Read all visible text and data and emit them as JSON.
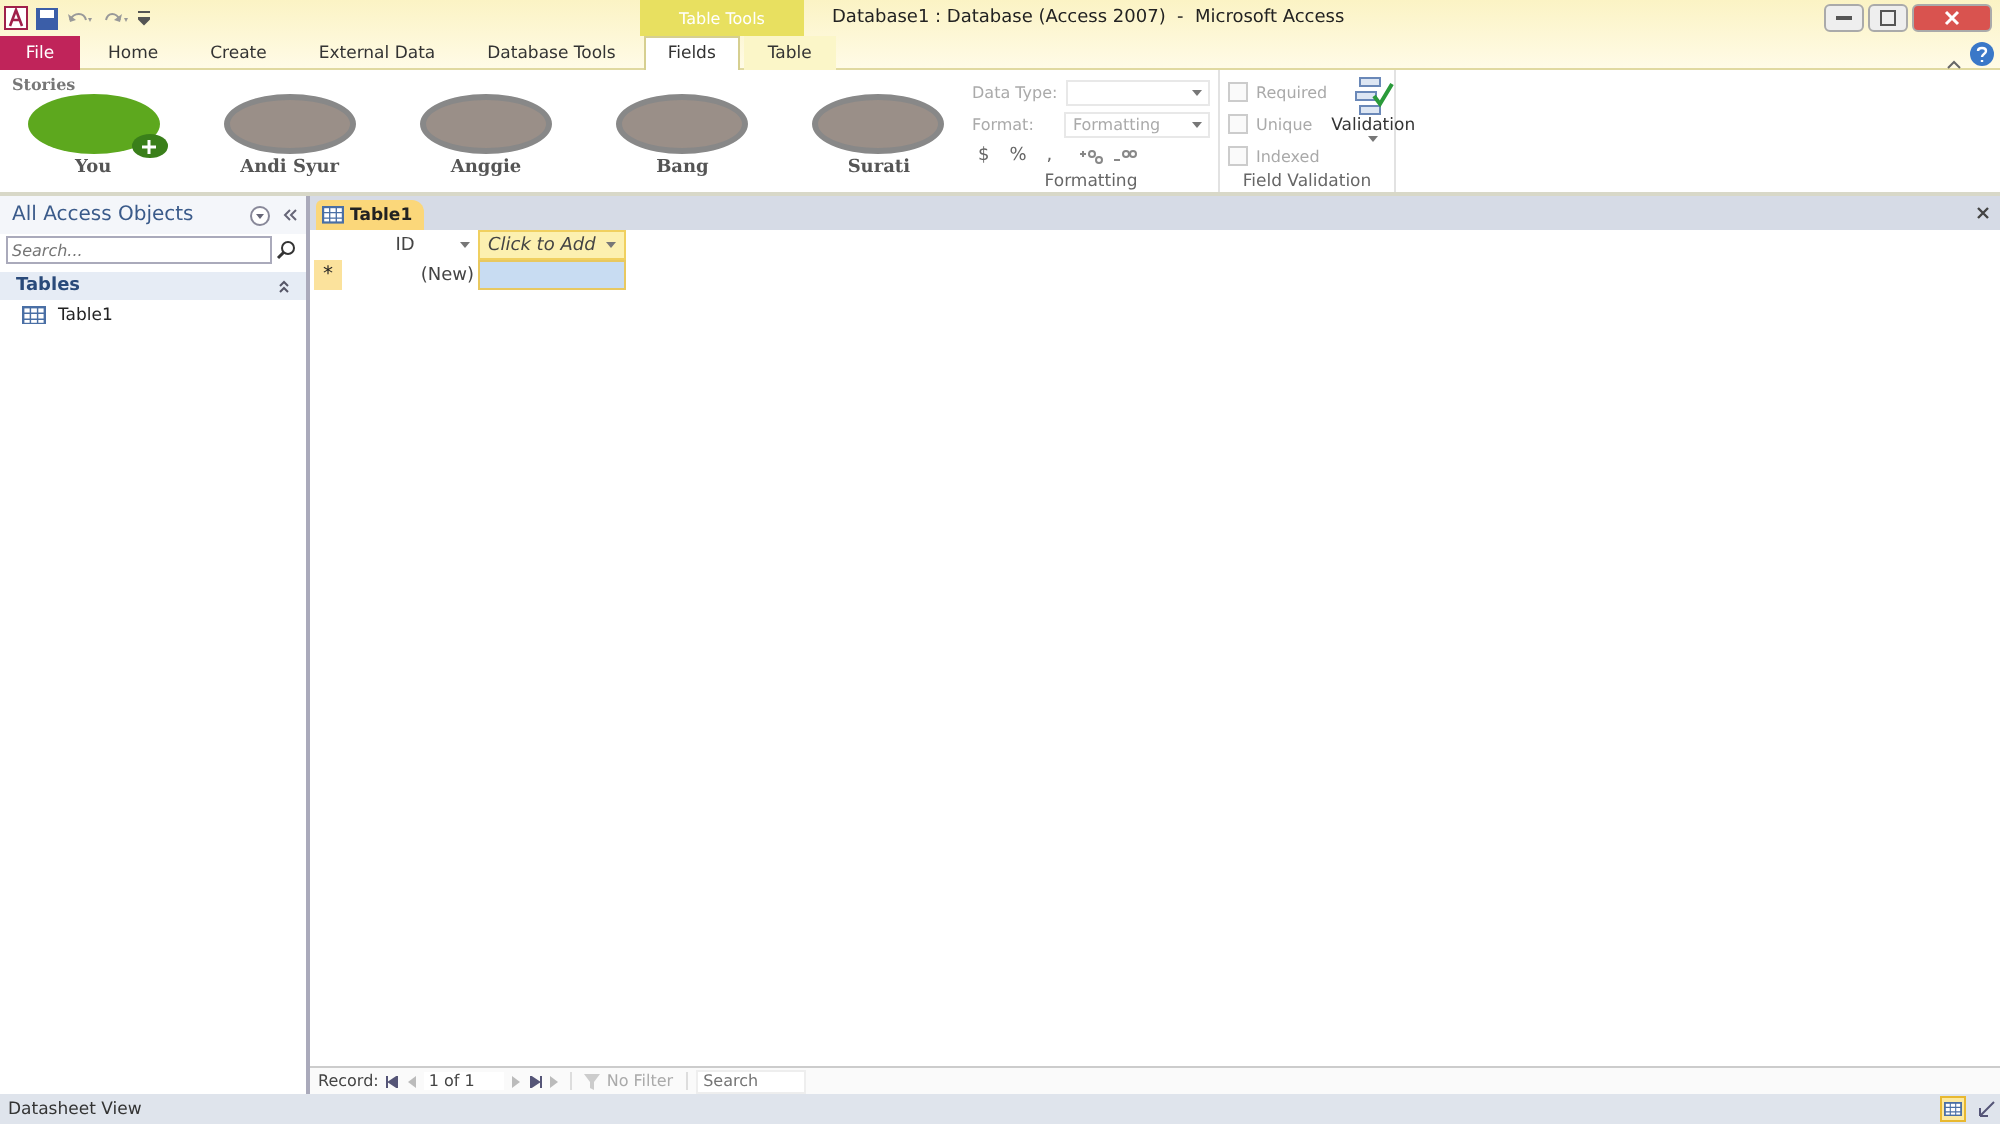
{
  "window": {
    "title": "Database1 : Database (Access 2007)  -  Microsoft Access",
    "context_group": "Table Tools"
  },
  "ribbon_tabs": [
    {
      "label": "File",
      "kind": "file",
      "selected": false
    },
    {
      "label": "Home",
      "kind": "normal",
      "selected": false
    },
    {
      "label": "Create",
      "kind": "normal",
      "selected": false
    },
    {
      "label": "External Data",
      "kind": "normal",
      "selected": false
    },
    {
      "label": "Database Tools",
      "kind": "normal",
      "selected": false
    },
    {
      "label": "Fields",
      "kind": "context",
      "selected": true
    },
    {
      "label": "Table",
      "kind": "context",
      "selected": false
    }
  ],
  "stories": {
    "title": "Stories",
    "items": [
      {
        "name": "You",
        "kind": "add"
      },
      {
        "name": "Andi Syur",
        "kind": "friend"
      },
      {
        "name": "Anggie",
        "kind": "friend"
      },
      {
        "name": "Bang",
        "kind": "friend"
      },
      {
        "name": "Surati",
        "kind": "friend"
      }
    ]
  },
  "formatting": {
    "data_type_label": "Data Type:",
    "format_label": "Format:",
    "format_value": "Formatting",
    "symbols": [
      "$",
      "%",
      ","
    ],
    "group_label": "Formatting"
  },
  "field_validation": {
    "checkboxes": [
      {
        "label": "Required",
        "checked": false
      },
      {
        "label": "Unique",
        "checked": false
      },
      {
        "label": "Indexed",
        "checked": false
      }
    ],
    "button": "Validation",
    "group_label": "Field Validation"
  },
  "nav_pane": {
    "title": "All Access Objects",
    "search_placeholder": "Search...",
    "group": "Tables",
    "items": [
      {
        "label": "Table1",
        "selected": false
      }
    ]
  },
  "document_tab": {
    "label": "Table1"
  },
  "datasheet": {
    "columns": [
      "ID",
      "Click to Add"
    ],
    "new_row_marker": "*",
    "new_row_value": "(New)"
  },
  "record_nav": {
    "label": "Record:",
    "position": "1 of 1",
    "filter": "No Filter",
    "search_placeholder": "Search"
  },
  "status_bar": {
    "text": "Datasheet View"
  }
}
